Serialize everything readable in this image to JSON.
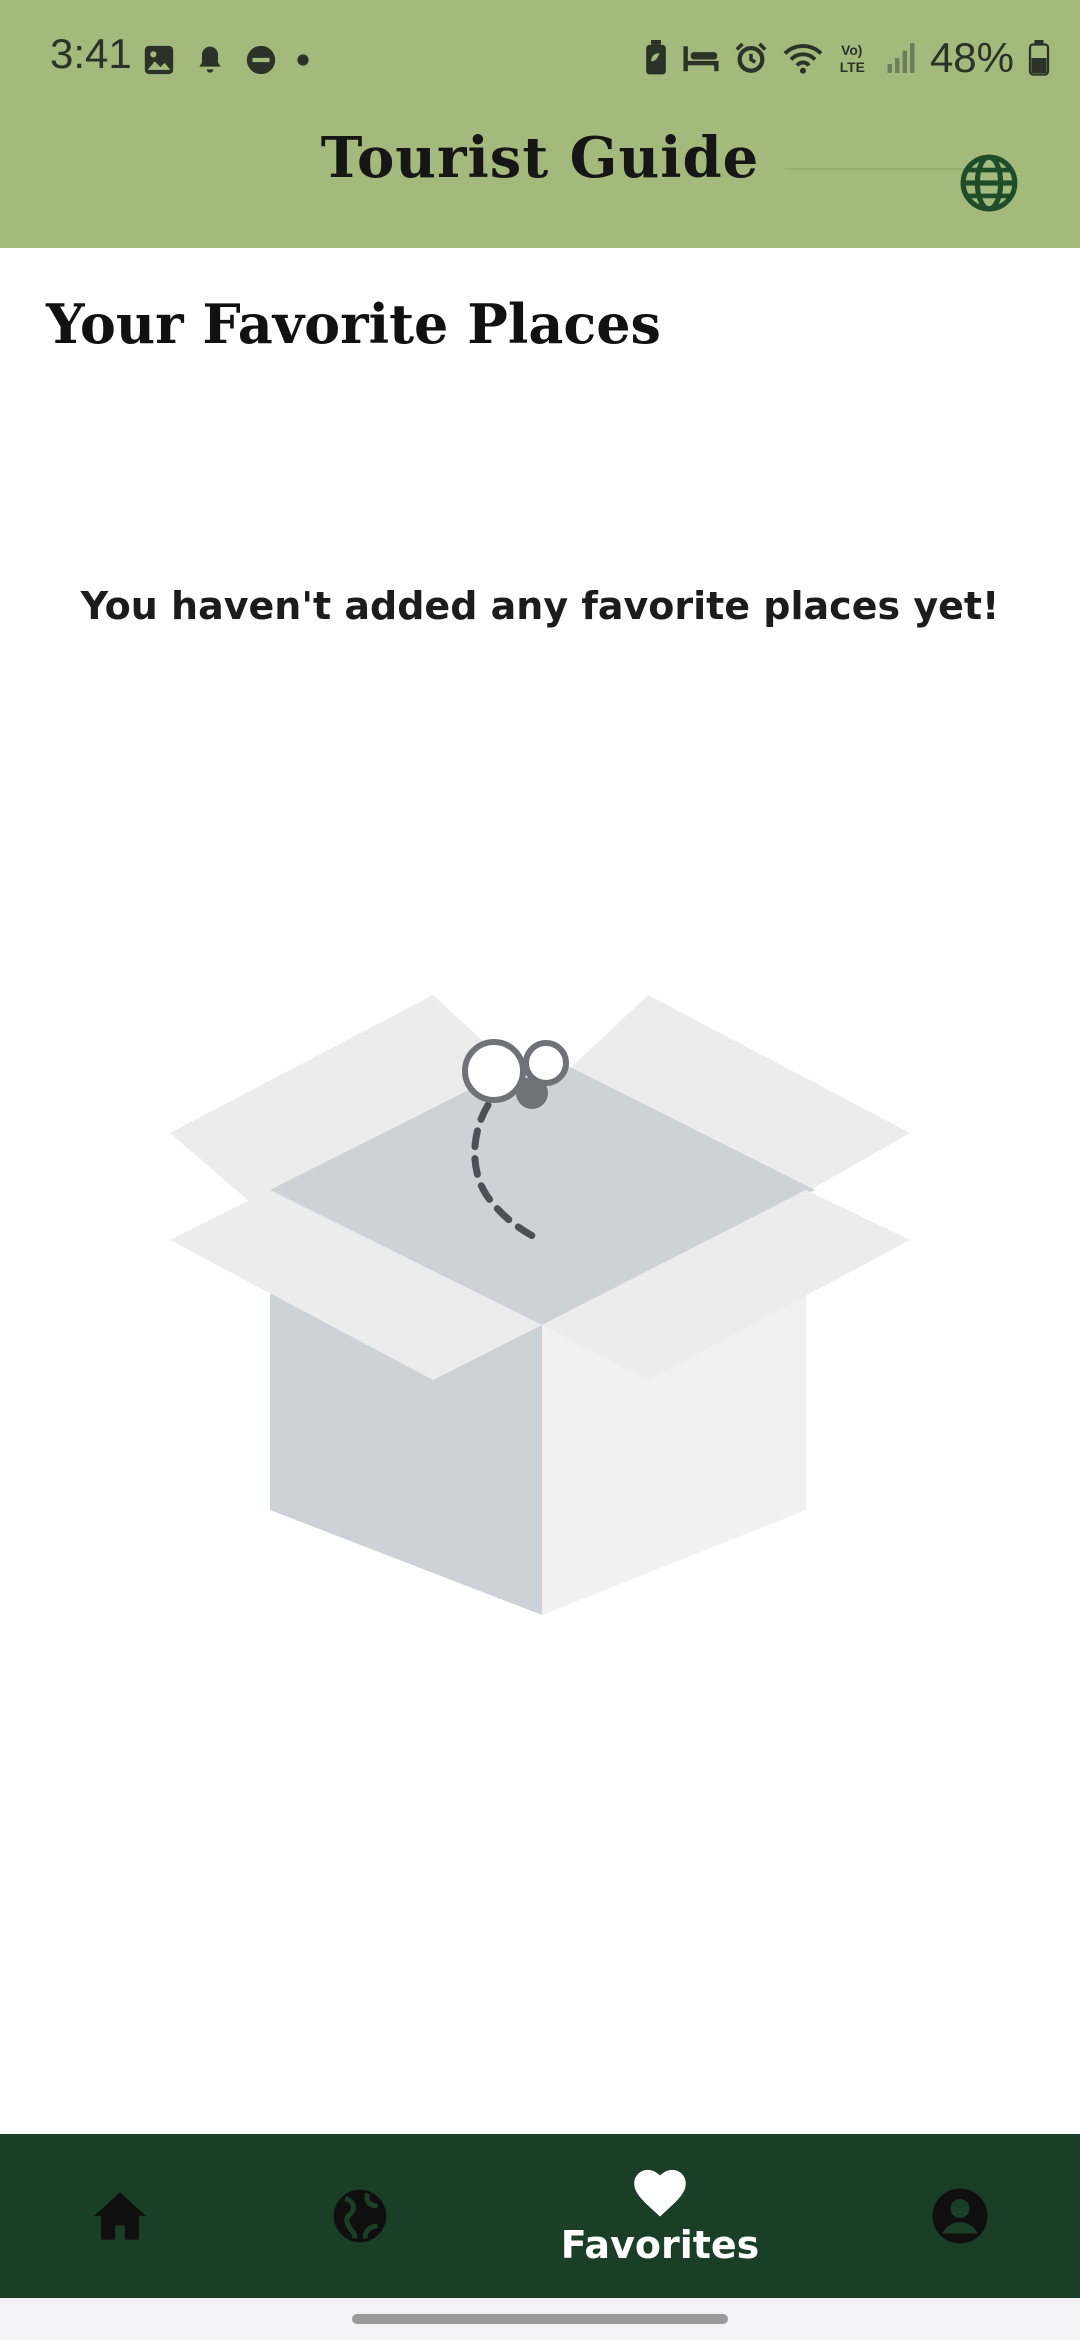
{
  "status_bar": {
    "time": "3:41",
    "battery_percent": "48%",
    "left_icons": [
      "gallery-icon",
      "notification-bell-icon",
      "do-not-disturb-icon",
      "dot-icon"
    ],
    "right_icons": [
      "battery-saver-icon",
      "bed-icon",
      "alarm-icon",
      "wifi-icon",
      "volte-icon",
      "signal-icon",
      "battery-icon"
    ]
  },
  "header": {
    "title": "Tourist Guide",
    "language_icon": "globe-icon"
  },
  "main": {
    "title": "Your Favorite Places",
    "empty_message": "You haven't added any favorite places yet!",
    "illustration": "empty-box"
  },
  "bottom_nav": {
    "items": [
      {
        "name": "home",
        "icon": "home-icon",
        "label": ""
      },
      {
        "name": "explore",
        "icon": "globe-icon",
        "label": ""
      },
      {
        "name": "favorites",
        "icon": "heart-icon",
        "label": "Favorites",
        "active": true
      },
      {
        "name": "profile",
        "icon": "account-icon",
        "label": ""
      }
    ]
  },
  "colors": {
    "header_bg": "#a4b97c",
    "nav_bg": "#1b3f26",
    "globe": "#1f4d2a"
  }
}
